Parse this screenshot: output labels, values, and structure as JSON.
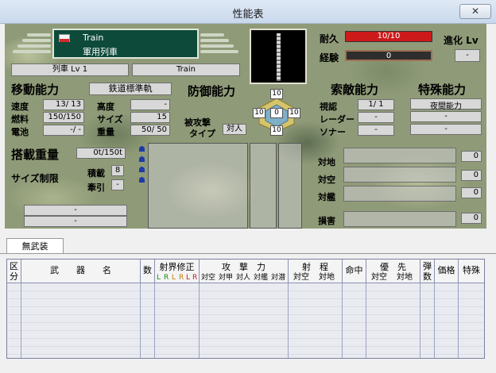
{
  "window": {
    "title": "性能表",
    "close_glyph": "✕"
  },
  "unit": {
    "name_en": "Train",
    "name_jp": "軍用列車",
    "rank": "列車 Lv 1",
    "class": "Train"
  },
  "stats": {
    "endurance_label": "耐久",
    "endurance_value": "10/10",
    "endurance_fill": 1.0,
    "exp_label": "経験",
    "exp_value": "0",
    "exp_fill": 0.0,
    "evolve_label": "進化 Lv",
    "evolve_value": "-"
  },
  "mobility": {
    "title": "移動能力",
    "move_type": "鉄道標準軌",
    "speed_label": "速度",
    "speed": "13/ 13",
    "alt_label": "高度",
    "alt": "-",
    "fuel_label": "燃料",
    "fuel": "150/150",
    "size_label": "サイズ",
    "size": "15",
    "battery_label": "電池",
    "battery": "-/ -",
    "weight_label": "重量",
    "weight": "50/ 50"
  },
  "defense": {
    "title": "防御能力",
    "attacked_label": "被攻撃",
    "type_label": "タイプ",
    "type_value": "対人",
    "top": "10",
    "left": "10",
    "center": "0",
    "right": "10",
    "bottom": "10"
  },
  "search": {
    "title": "索敵能力",
    "vision_label": "視認",
    "vision": "1/ 1",
    "radar_label": "レーダー",
    "radar": "-",
    "sonar_label": "ソナー",
    "sonar": "-"
  },
  "special": {
    "title": "特殊能力",
    "items": [
      "夜間能力",
      "-",
      "-"
    ]
  },
  "cargo": {
    "weight_label": "搭載重量",
    "weight_value": "0t/150t",
    "size_limit_label": "サイズ制限",
    "load_label": "積載",
    "load_value": "8",
    "tow_label": "牽引",
    "tow_value": "-",
    "bottom_values": [
      "-",
      "-"
    ]
  },
  "attack_vs": {
    "ground_label": "対地",
    "ground": "0",
    "air_label": "対空",
    "air": "0",
    "ship_label": "対艦",
    "ship": "0",
    "damage_label": "損害",
    "damage": "0"
  },
  "tabs": {
    "active": "無武装"
  },
  "weapon_header": {
    "kubun": "区分",
    "weapon": "武　　器　　名",
    "count": "数",
    "range_fix": "射界修正",
    "rf_sub": [
      "L",
      "R",
      "L",
      "R",
      "L",
      "R"
    ],
    "attack": "攻　撃　力",
    "attack_sub": [
      "対空",
      "対甲",
      "対人",
      "対艦",
      "対潜"
    ],
    "range": "射　程",
    "range_sub": [
      "対空",
      "対地"
    ],
    "accuracy": "命中",
    "priority": "優　先",
    "priority_sub": [
      "対空",
      "対地"
    ],
    "ammo": "弾数",
    "price": "価格",
    "special": "特殊"
  }
}
